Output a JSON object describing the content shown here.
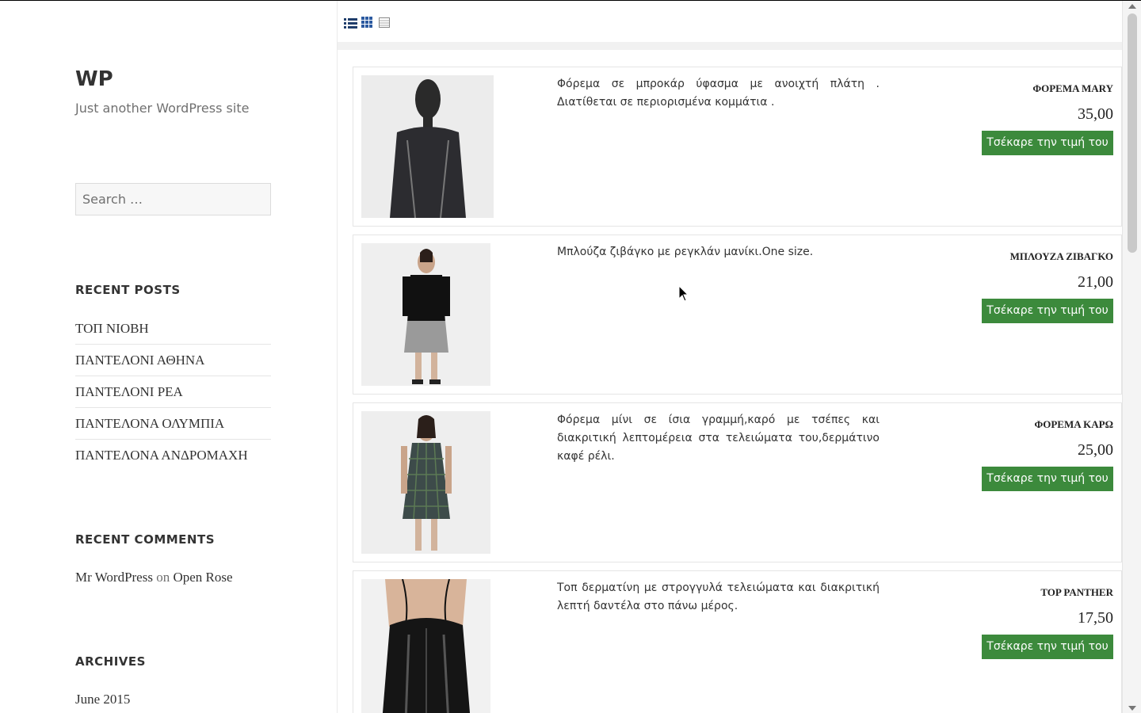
{
  "site": {
    "title": "WP",
    "description": "Just another WordPress site"
  },
  "search": {
    "placeholder": "Search …"
  },
  "recent_posts": {
    "heading": "RECENT POSTS",
    "items": [
      "ΤΟΠ ΝΙΟΒΗ",
      "ΠΑΝΤΕΛΟΝΙ ΑΘΗΝΑ",
      "ΠΑΝΤΕΛΟΝΙ ΡΕΑ",
      "ΠΑΝΤΕΛΟΝΑ ΟΛΥΜΠΙΑ",
      "ΠΑΝΤΕΛΟΝΑ ΑΝΔΡΟΜΑΧΗ"
    ]
  },
  "recent_comments": {
    "heading": "RECENT COMMENTS",
    "author": "Mr WordPress",
    "on": "on",
    "post": "Open Rose"
  },
  "archives": {
    "heading": "ARCHIVES",
    "items": [
      "June 2015"
    ]
  },
  "view_modes": [
    "list-view-icon",
    "grid-view-icon",
    "table-view-icon"
  ],
  "products": [
    {
      "name": "ΦΟΡΕΜΑ MARY",
      "price": "35,00",
      "description": "Φόρεμα σε μπροκάρ ύφασμα με ανοιχτή πλάτη . Διατίθεται σε περιορισμένα κομμάτια .",
      "button": "Τσέκαρε την τιμή του"
    },
    {
      "name": "ΜΠΛΟΥΖΑ ΖΙΒΑΓΚΟ",
      "price": "21,00",
      "description": "Μπλούζα ζιβάγκο με ρεγκλάν μανίκι.One size.",
      "button": "Τσέκαρε την τιμή του"
    },
    {
      "name": "ΦΟΡΕΜΑ ΚΑΡΩ",
      "price": "25,00",
      "description": "Φόρεμα μίνι σε ίσια γραμμή,καρό με τσέπες και διακριτική λεπτομέρεια στα τελειώματα του,δερμάτινο καφέ ρέλι.",
      "button": "Τσέκαρε την τιμή του"
    },
    {
      "name": "TOP PANTHER",
      "price": "17,50",
      "description": "Τοπ δερματίνη με στρογγυλά τελειώματα και διακριτική λεπτή δαντέλα στο πάνω μέρος.",
      "button": "Τσέκαρε την τιμή του"
    }
  ],
  "colors": {
    "button_bg": "#3c8a3c",
    "button_text": "#ffffff"
  }
}
